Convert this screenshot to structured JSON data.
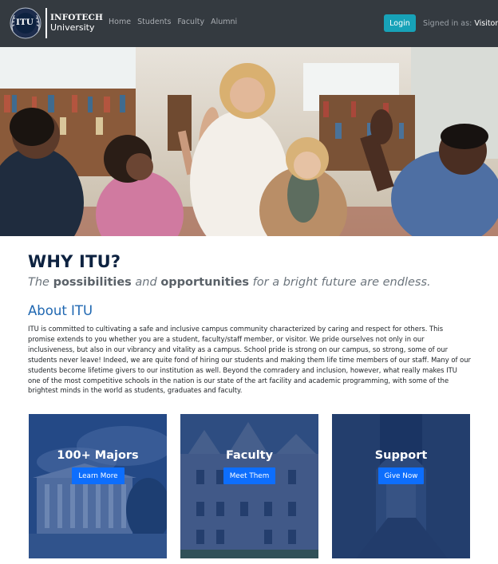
{
  "navbar": {
    "seal_text": "ITU",
    "brand_name": "INFOTECH",
    "brand_sub": "University",
    "links": [
      {
        "label": "Home"
      },
      {
        "label": "Students"
      },
      {
        "label": "Faculty"
      },
      {
        "label": "Alumni"
      }
    ],
    "login_label": "Login",
    "signed_in_prefix": "Signed in as:",
    "signed_in_user": "Visitor"
  },
  "hero": {
    "icon": "group-photo"
  },
  "why": {
    "title": "WHY ITU?",
    "tagline": {
      "w1": "The",
      "w2": "possibilities",
      "w3": "and",
      "w4": "opportunities",
      "w5": "for a bright future are endless."
    }
  },
  "about": {
    "title": "About ITU",
    "body": "ITU is committed to cultivating a safe and inclusive campus community characterized by caring and respect for others. This promise extends to you whether you are a student, faculty/staff member, or visitor. We pride ourselves not only in our inclusiveness, but also in our vibrancy and vitality as a campus. School pride is strong on our campus, so strong, some of our students never leave! Indeed, we are quite fond of hiring our students and making them life time members of our staff. Many of our students become lifetime givers to our institution as well. Beyond the comradery and inclusion, however, what really makes ITU one of the most competitive schools in the nation is our state of the art facility and academic programming, with some of the brightest minds in the world as students, graduates and faculty."
  },
  "cards": [
    {
      "title": "100+ Majors",
      "button": "Learn More"
    },
    {
      "title": "Faculty",
      "button": "Meet Them"
    },
    {
      "title": "Support",
      "button": "Give Now"
    }
  ],
  "colors": {
    "navbar_bg": "#343a40",
    "login_btn": "#17a2b8",
    "heading_navy": "#0d2240",
    "about_blue": "#1f67b1",
    "card_btn": "#0d6efd"
  }
}
